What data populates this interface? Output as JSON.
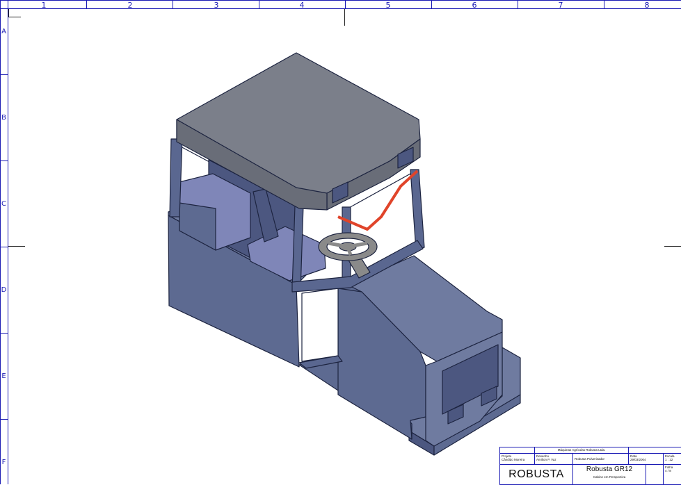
{
  "border": {
    "columns": [
      "1",
      "2",
      "3",
      "4",
      "5",
      "6",
      "7",
      "8"
    ],
    "rows": [
      "A",
      "B",
      "C",
      "D",
      "E",
      "F"
    ],
    "color": "#1a1ab4"
  },
  "drawing": {
    "subject": "cabin",
    "colors": {
      "roof_top": "#7b7f8a",
      "roof_front": "#696d78",
      "body_light": "#6f7ba0",
      "body_mid": "#5d6a91",
      "body_dark": "#4c5780",
      "seat": "#7f86b8",
      "glass": "#ffffff",
      "frame": "#5a6790",
      "steering_wheel": "#8a8a8a",
      "handle": "#e0442a",
      "outline": "#1d2440"
    }
  },
  "title_block": {
    "company": "Máquinas Agrícolas Robusta Ltda.",
    "projeto_label": "Projeto",
    "projeto_value": "Cândido Moreira",
    "desenho_label": "Desenho",
    "desenho_value": "Amilton P. Vaz",
    "descricao": "Robusta Pulverizador",
    "data_label": "Data",
    "data_value": "29/03/2004",
    "escala_label": "Escala",
    "escala_value": "1 : 12",
    "brand": "ROBUSTA",
    "model": "Robusta GR12",
    "view": "Cabine em Perspectiva",
    "folha_label": "Folha",
    "folha_value": "4 / 8"
  }
}
